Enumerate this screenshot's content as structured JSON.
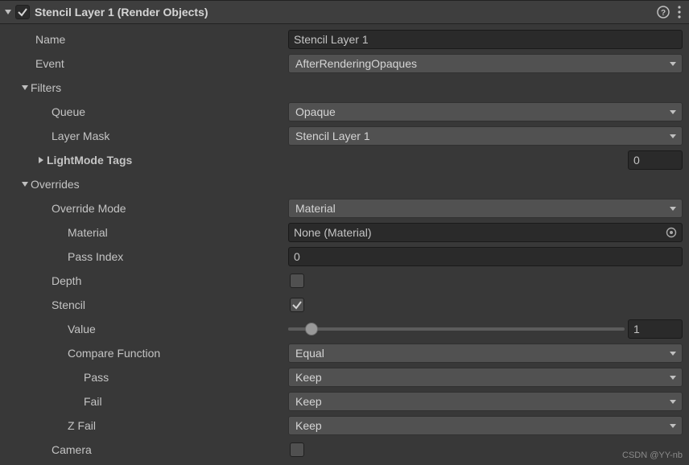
{
  "header": {
    "title": "Stencil Layer 1 (Render Objects)",
    "enabled": true
  },
  "name": {
    "label": "Name",
    "value": "Stencil Layer 1"
  },
  "event": {
    "label": "Event",
    "value": "AfterRenderingOpaques"
  },
  "filters": {
    "label": "Filters",
    "queue": {
      "label": "Queue",
      "value": "Opaque"
    },
    "layerMask": {
      "label": "Layer Mask",
      "value": "Stencil Layer 1"
    },
    "lightModeTags": {
      "label": "LightMode Tags",
      "count": "0"
    }
  },
  "overrides": {
    "label": "Overrides",
    "mode": {
      "label": "Override Mode",
      "value": "Material"
    },
    "material": {
      "label": "Material",
      "value": "None (Material)"
    },
    "passIndex": {
      "label": "Pass Index",
      "value": "0"
    },
    "depth": {
      "label": "Depth",
      "checked": false
    },
    "stencil": {
      "label": "Stencil",
      "checked": true,
      "value": {
        "label": "Value",
        "num": "1",
        "percent": 7
      },
      "compare": {
        "label": "Compare Function",
        "value": "Equal"
      },
      "pass": {
        "label": "Pass",
        "value": "Keep"
      },
      "fail": {
        "label": "Fail",
        "value": "Keep"
      },
      "zfail": {
        "label": "Z Fail",
        "value": "Keep"
      }
    },
    "camera": {
      "label": "Camera",
      "checked": false
    }
  },
  "watermark": "CSDN @YY-nb"
}
